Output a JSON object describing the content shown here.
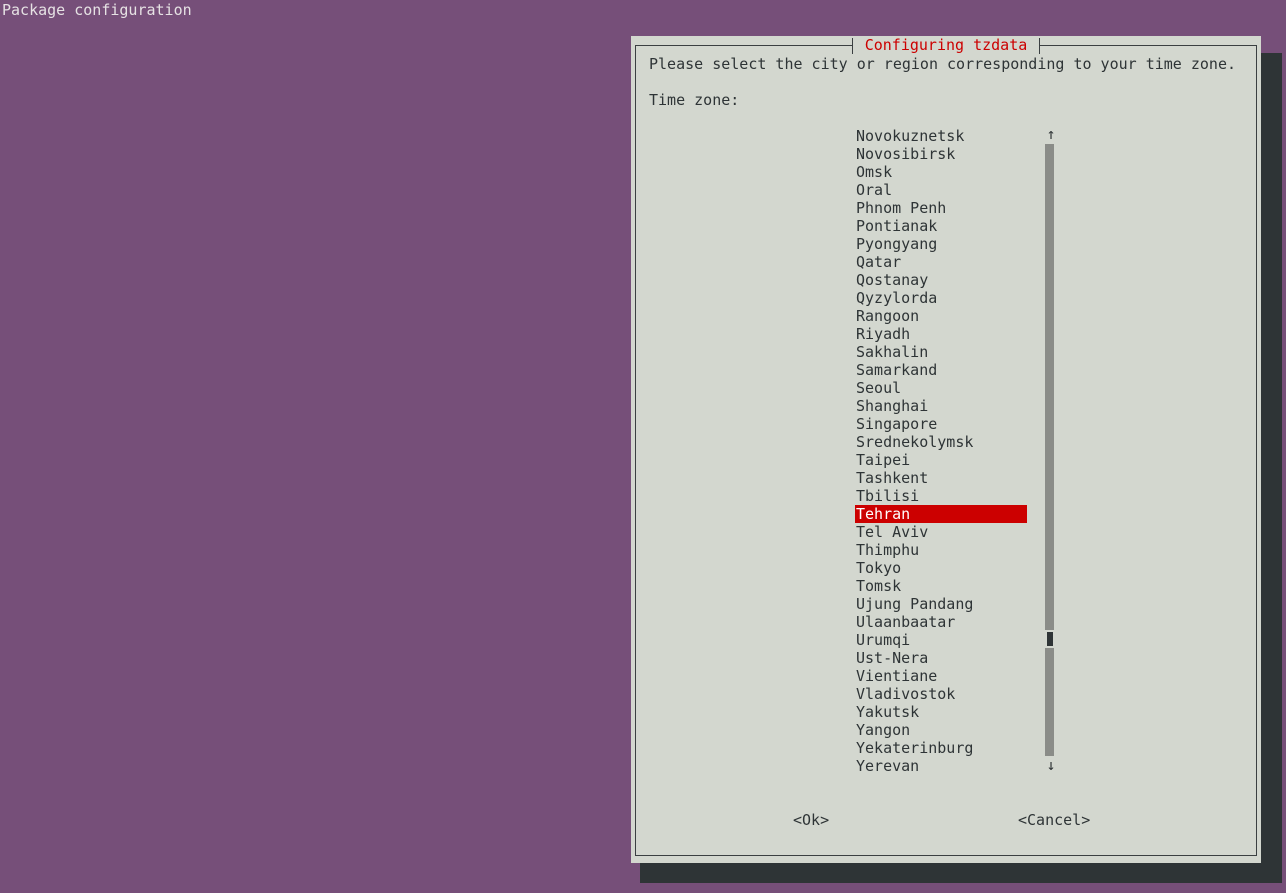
{
  "screen": {
    "title": "Package configuration"
  },
  "dialog": {
    "title": "Configuring tzdata",
    "prompt": "Please select the city or region corresponding to your time zone.",
    "list_label": "Time zone:",
    "items": [
      "Novokuznetsk",
      "Novosibirsk",
      "Omsk",
      "Oral",
      "Phnom Penh",
      "Pontianak",
      "Pyongyang",
      "Qatar",
      "Qostanay",
      "Qyzylorda",
      "Rangoon",
      "Riyadh",
      "Sakhalin",
      "Samarkand",
      "Seoul",
      "Shanghai",
      "Singapore",
      "Srednekolymsk",
      "Taipei",
      "Tashkent",
      "Tbilisi",
      "Tehran",
      "Tel Aviv",
      "Thimphu",
      "Tokyo",
      "Tomsk",
      "Ujung Pandang",
      "Ulaanbaatar",
      "Urumqi",
      "Ust-Nera",
      "Vientiane",
      "Vladivostok",
      "Yakutsk",
      "Yangon",
      "Yekaterinburg",
      "Yerevan"
    ],
    "selected": "Tehran",
    "scroll_up_glyph": "↑",
    "scroll_down_glyph": "↓",
    "ok_label": "<Ok>",
    "cancel_label": "<Cancel>"
  },
  "colors": {
    "background": "#764f79",
    "dialog": "#d3d7cf",
    "accent": "#cc0000",
    "shadow": "#2e3436"
  }
}
